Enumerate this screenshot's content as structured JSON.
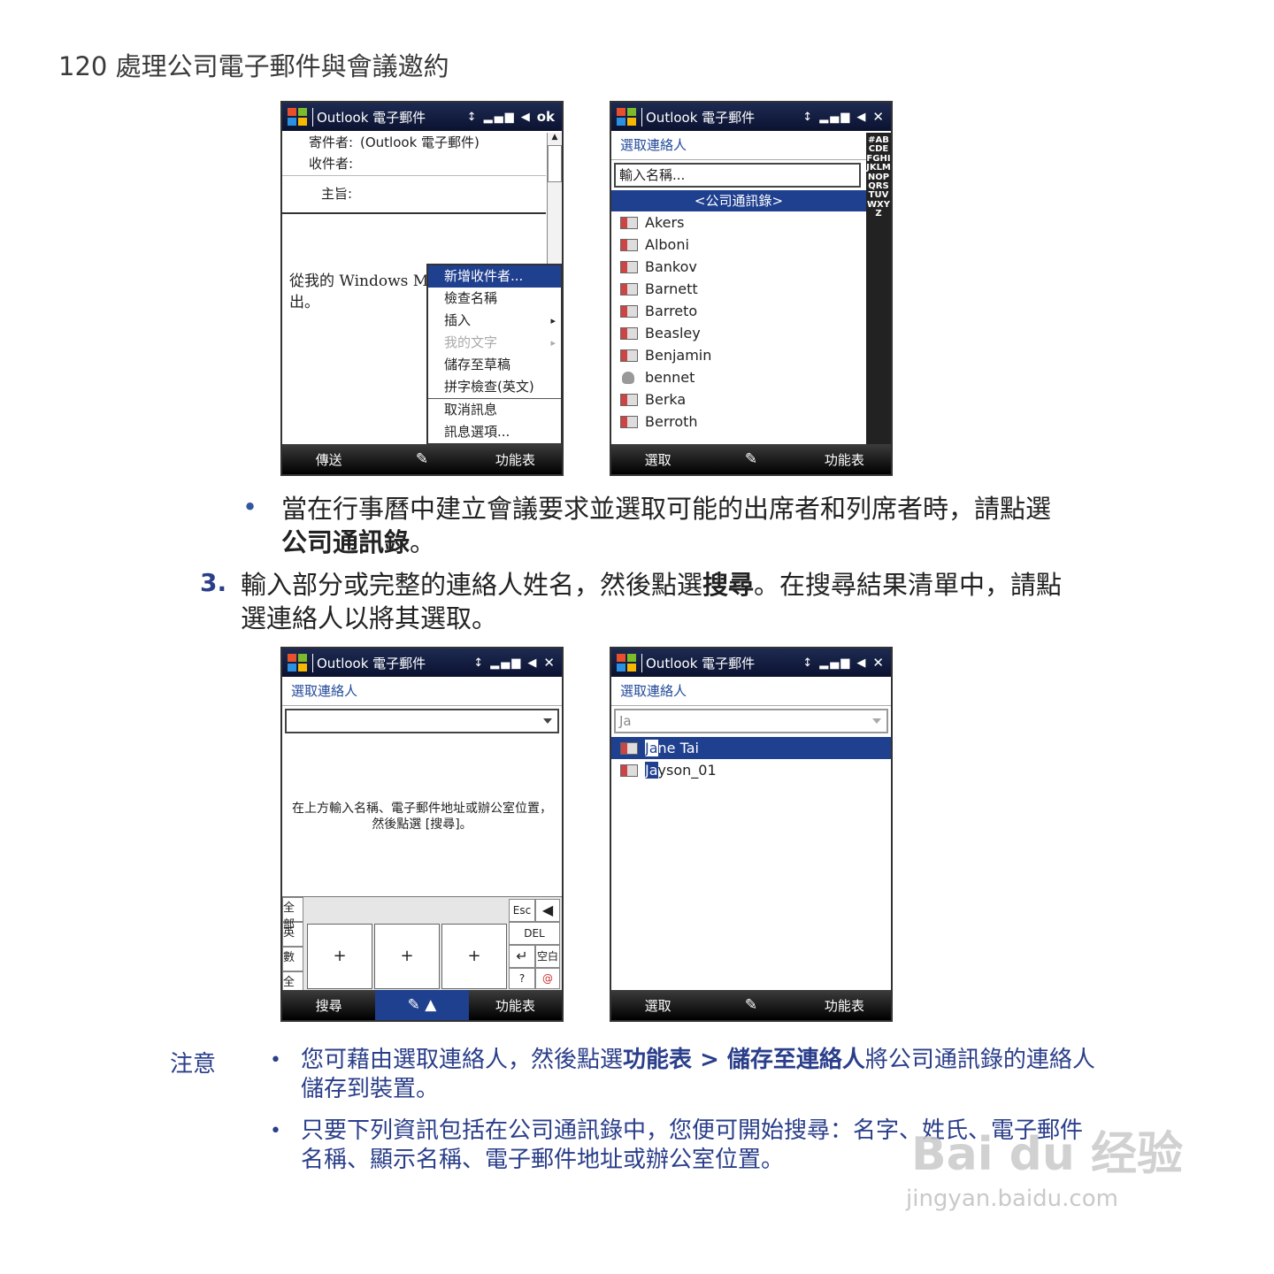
{
  "page": {
    "header": "120 處理公司電子郵件與會議邀約"
  },
  "screen1": {
    "title": "Outlook 電子郵件",
    "status_icons": "↕ ▂▄▆ ◀",
    "ok": "ok",
    "from_label": "寄件者:",
    "from_value": "(Outlook 電子郵件)",
    "to_label": "收件者:",
    "subject_label": "主旨:",
    "body_line1": "從我的 Windows M",
    "body_line2": "出。",
    "menu": [
      "新增收件者...",
      "檢查名稱",
      "插入",
      "我的文字",
      "儲存至草稿",
      "拼字檢查(英文)",
      "取消訊息",
      "訊息選項..."
    ],
    "soft_left": "傳送",
    "soft_right": "功能表"
  },
  "screen2": {
    "title": "Outlook 電子郵件",
    "header": "選取連絡人",
    "input_value": "輸入名稱...",
    "company_bar": "<公司通訊錄>",
    "contacts": [
      "Akers",
      "Alboni",
      "Bankov",
      "Barnett",
      "Barreto",
      "Beasley",
      "Benjamin",
      "bennet",
      "Berka",
      "Berroth"
    ],
    "alpha": "#ABCDEFGHIJKLMNOPQRSTUVWXYZ",
    "soft_left": "選取",
    "soft_right": "功能表"
  },
  "screen3": {
    "title": "Outlook 電子郵件",
    "header": "選取連絡人",
    "instruction": "在上方輸入名稱、電子郵件地址或辦公室位置，然後點選 [搜尋]。",
    "kb_side": [
      "全部",
      "英",
      "數",
      "全"
    ],
    "kb_keys": [
      "Esc",
      "DEL",
      "空白",
      "?"
    ],
    "soft_left": "搜尋",
    "soft_right": "功能表"
  },
  "screen4": {
    "title": "Outlook 電子郵件",
    "header": "選取連絡人",
    "input_value": "Ja",
    "results": [
      {
        "hl": "Ja",
        "rest": "ne Tai"
      },
      {
        "hl": "Ja",
        "rest": "yson_01"
      }
    ],
    "soft_left": "選取",
    "soft_right": "功能表"
  },
  "text": {
    "bullet_line1": "當在行事曆中建立會議要求並選取可能的出席者和列席者時，請點選",
    "bullet_bold": "公司通訊錄",
    "bullet_end": "。",
    "step_num": "3.",
    "step_line1a": "輸入部分或完整的連絡人姓名，然後點選",
    "step_bold": "搜尋",
    "step_line1b": "。在搜尋結果清單中，請點",
    "step_line2": "選連絡人以將其選取。",
    "note_label": "注意",
    "note1_a": "您可藉由選取連絡人，然後點選",
    "note1_bold1": "功能表 > 儲存至連絡人",
    "note1_b": "將公司通訊錄的連絡人",
    "note1_line2": "儲存到裝置。",
    "note2_line1": "只要下列資訊包括在公司通訊錄中，您便可開始搜尋：名字、姓氏、電子郵件",
    "note2_line2": "名稱、顯示名稱、電子郵件地址或辦公室位置。"
  },
  "watermark": {
    "logo": "Bai du 经验",
    "url": "jingyan.baidu.com"
  }
}
